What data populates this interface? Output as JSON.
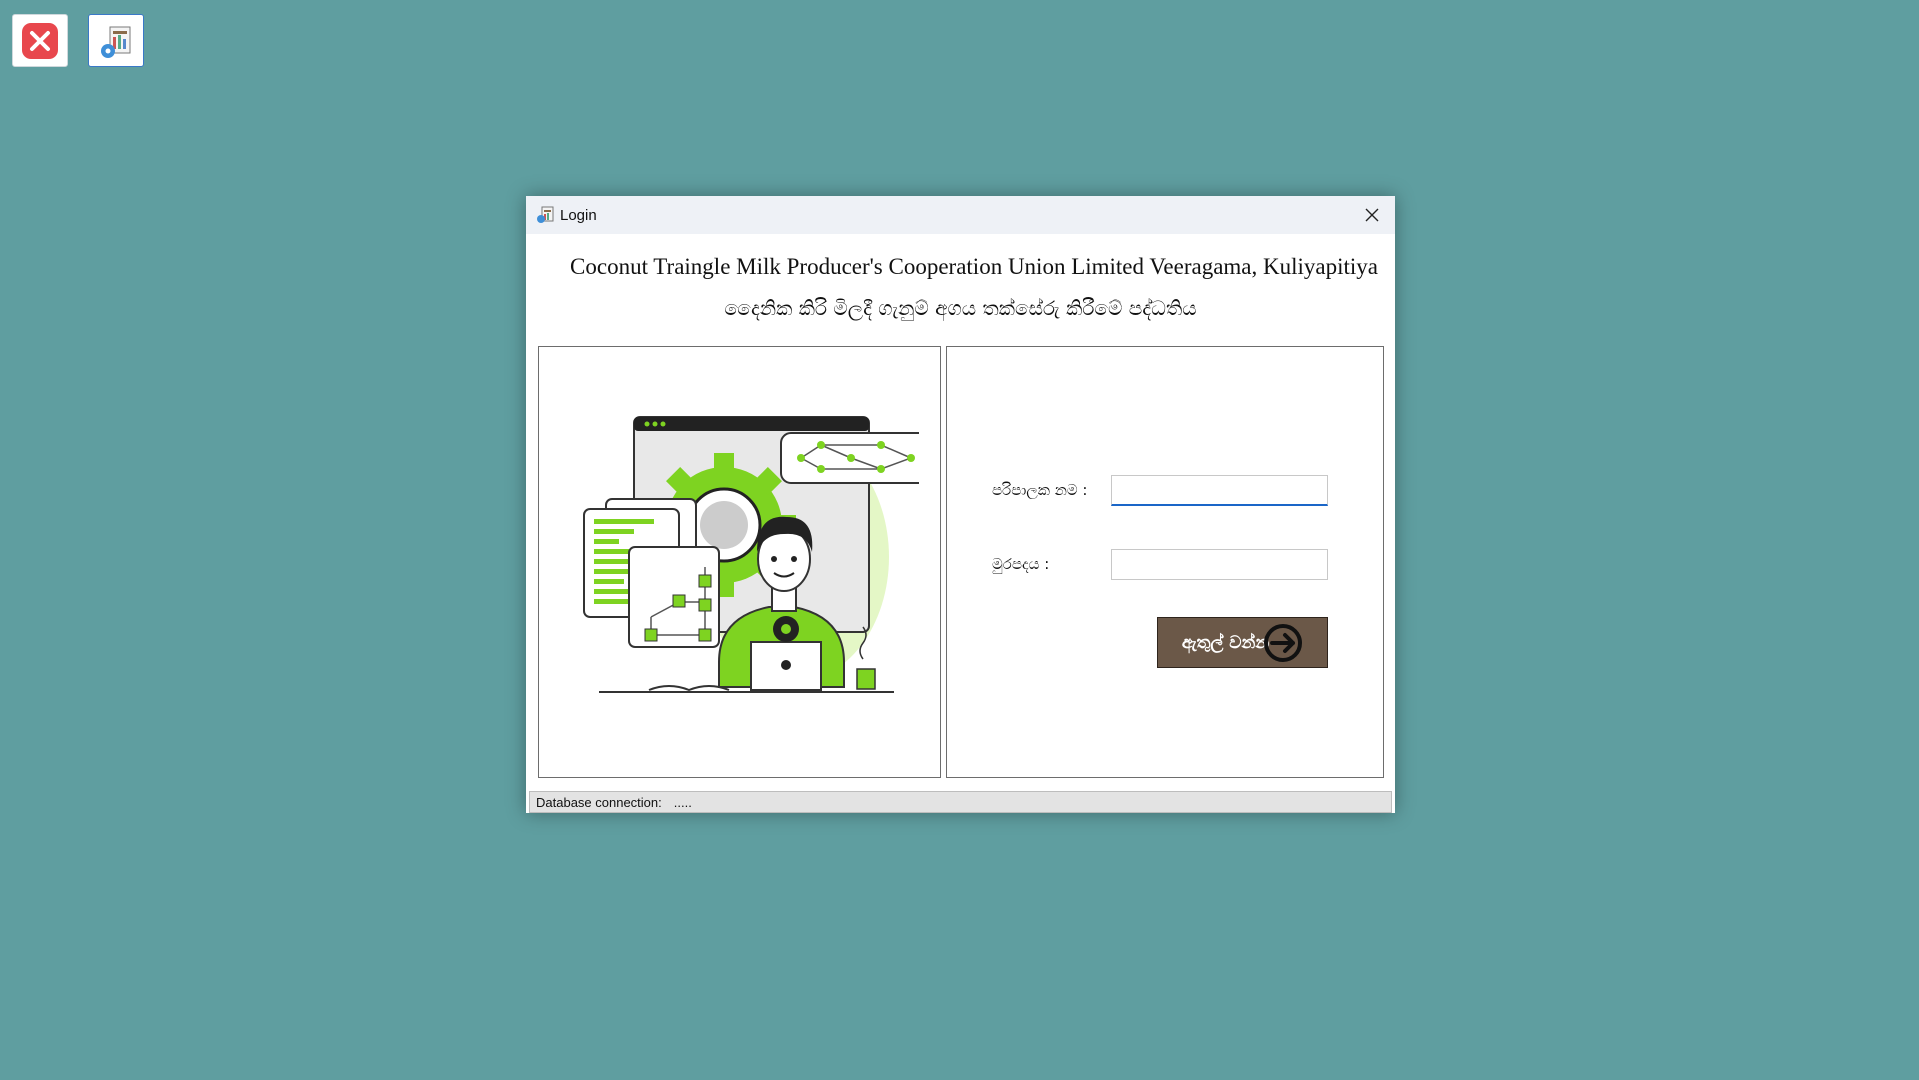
{
  "desktop": {
    "exit_icon": "close-x-icon",
    "config_icon": "database-settings-icon",
    "colors": {
      "background": "#5f9ea0",
      "exit_red": "#e8474d"
    }
  },
  "window": {
    "title": "Login",
    "org_title": "Coconut Traingle Milk Producer's Cooperation Union Limited Veeragama, Kuliyapitiya",
    "system_title": "දෛනික  කිරි මිලදී ගැනුම් අගය තක්සේරු කිරීමේ පද්ධතිය"
  },
  "form": {
    "username_label": "පරිපාලක නම :",
    "username_value": "",
    "password_label": "මුරපදය :",
    "password_value": "",
    "login_label": "ඇතුල් වන්න",
    "login_button_color": "#6b5848"
  },
  "status": {
    "label": "Database connection:",
    "value": "....."
  },
  "illustration": {
    "icon": "developer-with-gear-illustration",
    "accent": "#7ed321"
  }
}
